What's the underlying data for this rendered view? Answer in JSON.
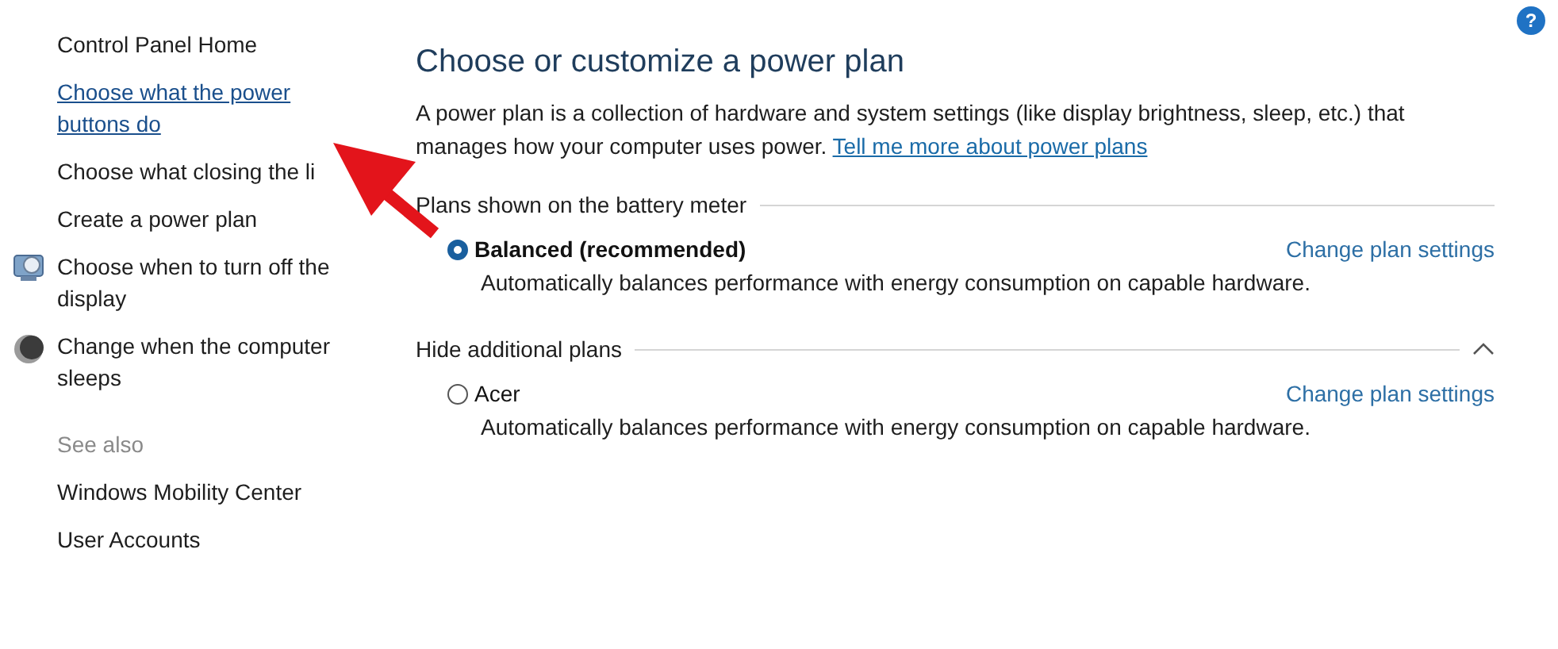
{
  "help_button": {
    "label": "?"
  },
  "sidebar": {
    "items": [
      {
        "label": "Control Panel Home",
        "kind": "text",
        "hovered": false
      },
      {
        "label": "Choose what the power buttons do",
        "kind": "text",
        "hovered": true
      },
      {
        "label": "Choose what closing the li",
        "kind": "text",
        "hovered": false
      },
      {
        "label": "Create a power plan",
        "kind": "text",
        "hovered": false
      },
      {
        "label": "Choose when to turn off the display",
        "kind": "monitor",
        "hovered": false
      },
      {
        "label": "Change when the computer sleeps",
        "kind": "moon",
        "hovered": false
      }
    ],
    "see_also": {
      "heading": "See also",
      "items": [
        "Windows Mobility Center",
        "User Accounts"
      ]
    }
  },
  "main": {
    "title": "Choose or customize a power plan",
    "description": "A power plan is a collection of hardware and system settings (like display brightness, sleep, etc.) that manages how your computer uses power.",
    "description_link": "Tell me more about power plans",
    "groups": [
      {
        "heading": "Plans shown on the battery meter",
        "collapse_toggle": false,
        "plans": [
          {
            "name": "Balanced (recommended)",
            "selected": true,
            "link": "Change plan settings",
            "description": "Automatically balances performance with energy consumption on capable hardware."
          }
        ]
      },
      {
        "heading": "Hide additional plans",
        "collapse_toggle": true,
        "plans": [
          {
            "name": "Acer",
            "selected": false,
            "link": "Change plan settings",
            "description": "Automatically balances performance with energy consumption on capable hardware."
          }
        ]
      }
    ]
  },
  "annotation": {
    "kind": "arrow"
  }
}
